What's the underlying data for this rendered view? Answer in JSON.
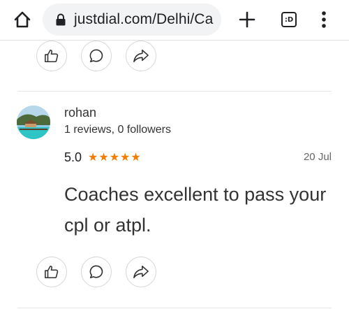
{
  "browser": {
    "url": "justdial.com/Delhi/Ca",
    "tab_switcher_label": ":D"
  },
  "review": {
    "reviewer_name": "rohan",
    "reviewer_meta": "1 reviews, 0 followers",
    "rating_value": "5.0",
    "stars": [
      "★",
      "★",
      "★",
      "★",
      "★"
    ],
    "date": "20 Jul",
    "text": "Coaches excellent to pass your cpl or atpl."
  },
  "colors": {
    "star": "#f57c00",
    "text": "#333333"
  },
  "icons": [
    "home-icon",
    "lock-icon",
    "plus-icon",
    "tab-switcher-icon",
    "more-vert-icon",
    "like-icon",
    "comment-icon",
    "share-icon"
  ]
}
